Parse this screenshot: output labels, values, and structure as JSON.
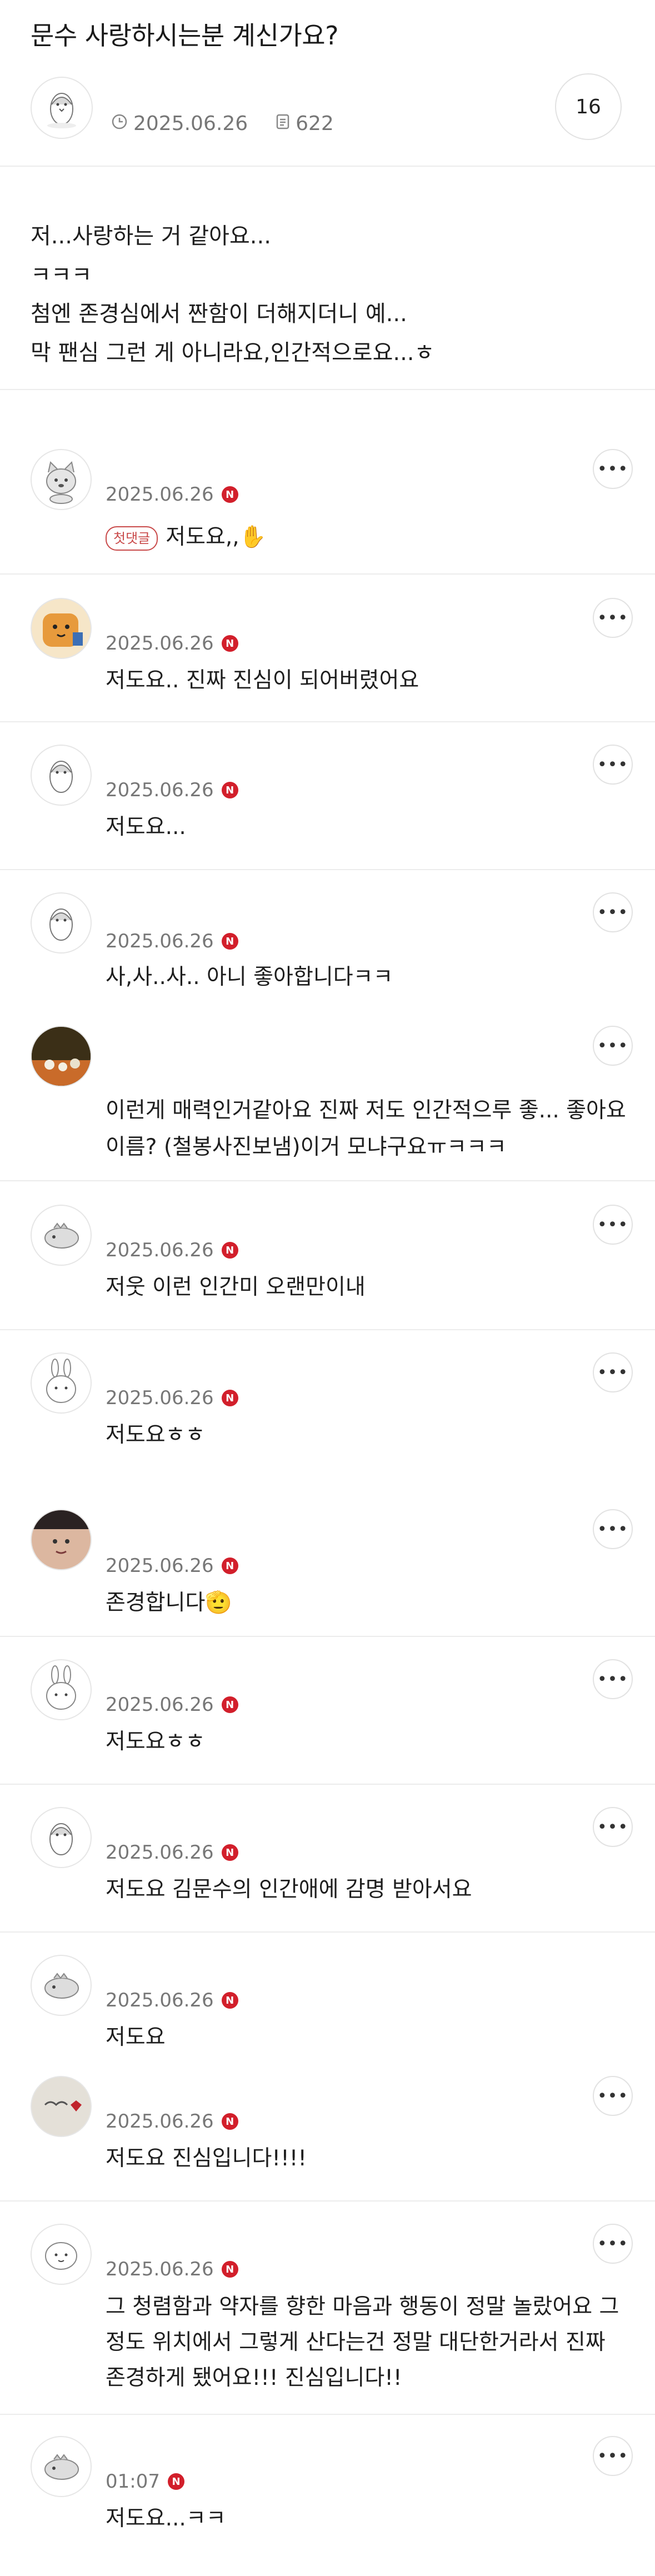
{
  "post": {
    "title": "문수 사랑하시는분 계신가요?",
    "date": "2025.06.26",
    "views": "622",
    "comment_count": "16",
    "body": [
      "저...사랑하는 거 같아요...",
      "ㅋㅋㅋ",
      "첨엔 존경심에서 짠함이 더해지더니 예...",
      "막 팬심 그런 게 아니라요,인간적으로요...ㅎ"
    ]
  },
  "comments": [
    {
      "date": "2025.06.26",
      "badge": "N",
      "first_label": "첫댓글",
      "text": "저도요,,",
      "emoji": "✋"
    },
    {
      "date": "2025.06.26",
      "badge": "N",
      "text": "저도요.. 진짜 진심이 되어버렸어요"
    },
    {
      "date": "2025.06.26",
      "badge": "N",
      "text": "저도요..."
    },
    {
      "date": "2025.06.26",
      "badge": "N",
      "text": "사,사..사..  아니 좋아합니다ㅋㅋ"
    },
    {
      "text": "이런게 매력인거같아요 진짜   저도 인간적으루 좋... 좋아요 이름?  (철봉사진보냄)이거 모냐구요ㅠㅋㅋㅋ"
    },
    {
      "date": "2025.06.26",
      "badge": "N",
      "text": "저웃 이런 인간미 오랜만이내"
    },
    {
      "date": "2025.06.26",
      "badge": "N",
      "text": "저도요ㅎㅎ"
    },
    {
      "date": "2025.06.26",
      "badge": "N",
      "text": "존경합니다",
      "emoji": "🫡"
    },
    {
      "date": "2025.06.26",
      "badge": "N",
      "text": "저도요ㅎㅎ"
    },
    {
      "date": "2025.06.26",
      "badge": "N",
      "text": "저도요 김문수의 인간애에 감명 받아서요"
    },
    {
      "date": "2025.06.26",
      "badge": "N",
      "text": "저도요"
    },
    {
      "date": "2025.06.26",
      "badge": "N",
      "text": "저도요 진심입니다!!!!"
    },
    {
      "date": "2025.06.26",
      "badge": "N",
      "text": "그 청렴함과 약자를 향한 마음과 행동이 정말 놀랐어요 그 정도 위치에서 그렇게 산다는건 정말 대단한거라서 진짜 존경하게 됐어요!!! 진심입니다!!"
    },
    {
      "date": "01:07",
      "badge": "N",
      "text": "저도요...ㅋㅋ"
    }
  ],
  "more_label": "•••",
  "colors": {
    "accent_red": "#d21f2b",
    "divider": "#ececec"
  }
}
